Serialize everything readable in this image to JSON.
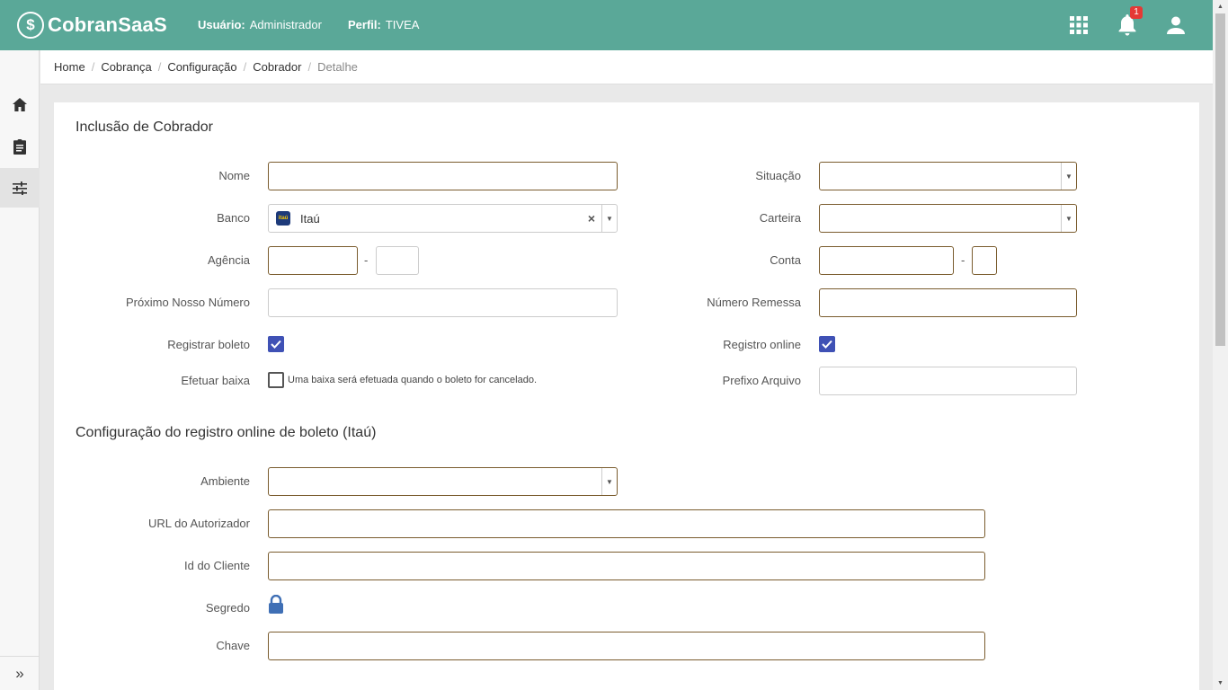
{
  "header": {
    "app_name": "CobranSaaS",
    "logo_mark": "$",
    "user_label": "Usuário:",
    "user_value": "Administrador",
    "profile_label": "Perfil:",
    "profile_value": "TIVEA",
    "notification_count": "1",
    "icons": [
      "apps-grid-icon",
      "bell-icon",
      "user-icon"
    ],
    "color": "#5aa898"
  },
  "sidebar": {
    "items": [
      {
        "icon": "home-icon"
      },
      {
        "icon": "clipboard-icon"
      },
      {
        "icon": "sliders-icon",
        "active": true
      }
    ],
    "footer_icon": "»"
  },
  "breadcrumb": [
    "Home",
    "Cobrança",
    "Configuração",
    "Cobrador",
    "Detalhe"
  ],
  "form": {
    "title": "Inclusão de Cobrador",
    "nome_label": "Nome",
    "nome_value": "",
    "situacao_label": "Situação",
    "situacao_value": "",
    "banco_label": "Banco",
    "banco_value": "Itaú",
    "banco_logo_text": "itaú",
    "carteira_label": "Carteira",
    "carteira_value": "",
    "agencia_label": "Agência",
    "agencia_value": "",
    "agencia_dv_value": "",
    "conta_label": "Conta",
    "conta_value": "",
    "conta_dv_value": "",
    "dash": "-",
    "proximo_label": "Próximo Nosso Número",
    "proximo_value": "",
    "remessa_label": "Número Remessa",
    "remessa_value": "",
    "registrar_label": "Registrar boleto",
    "registrar_checked": true,
    "registro_online_label": "Registro online",
    "registro_online_checked": true,
    "baixa_label": "Efetuar baixa",
    "baixa_checked": false,
    "baixa_hint": "Uma baixa será efetuada quando o boleto for cancelado.",
    "prefixo_label": "Prefixo Arquivo",
    "prefixo_value": ""
  },
  "online_config": {
    "title": "Configuração do registro online de boleto (Itaú)",
    "ambiente_label": "Ambiente",
    "ambiente_value": "",
    "url_label": "URL do Autorizador",
    "url_value": "",
    "cliente_label": "Id do Cliente",
    "cliente_value": "",
    "segredo_label": "Segredo",
    "segredo_icon": "lock-icon",
    "chave_label": "Chave",
    "chave_value": ""
  },
  "colors": {
    "accent": "#3f51b5",
    "field_border": "#7a5c2e"
  }
}
